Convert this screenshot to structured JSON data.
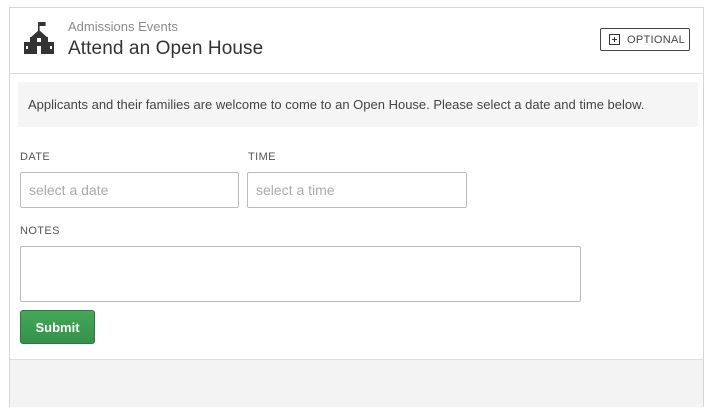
{
  "header": {
    "icon": "school-building-icon",
    "subtitle": "Admissions Events",
    "title": "Attend an Open House",
    "badge": {
      "icon": "plus-box-icon",
      "label": "OPTIONAL"
    }
  },
  "intro": {
    "text": "Applicants and their families are welcome to come to an Open House. Please select a date and time below."
  },
  "form": {
    "date": {
      "label": "DATE",
      "placeholder": "select a date",
      "value": ""
    },
    "time": {
      "label": "TIME",
      "placeholder": "select a time",
      "value": ""
    },
    "notes": {
      "label": "NOTES",
      "value": ""
    },
    "submit_label": "Submit"
  },
  "colors": {
    "submit": "#3a9d50",
    "panel": "#f5f5f5",
    "border": "#d6d6d6"
  }
}
